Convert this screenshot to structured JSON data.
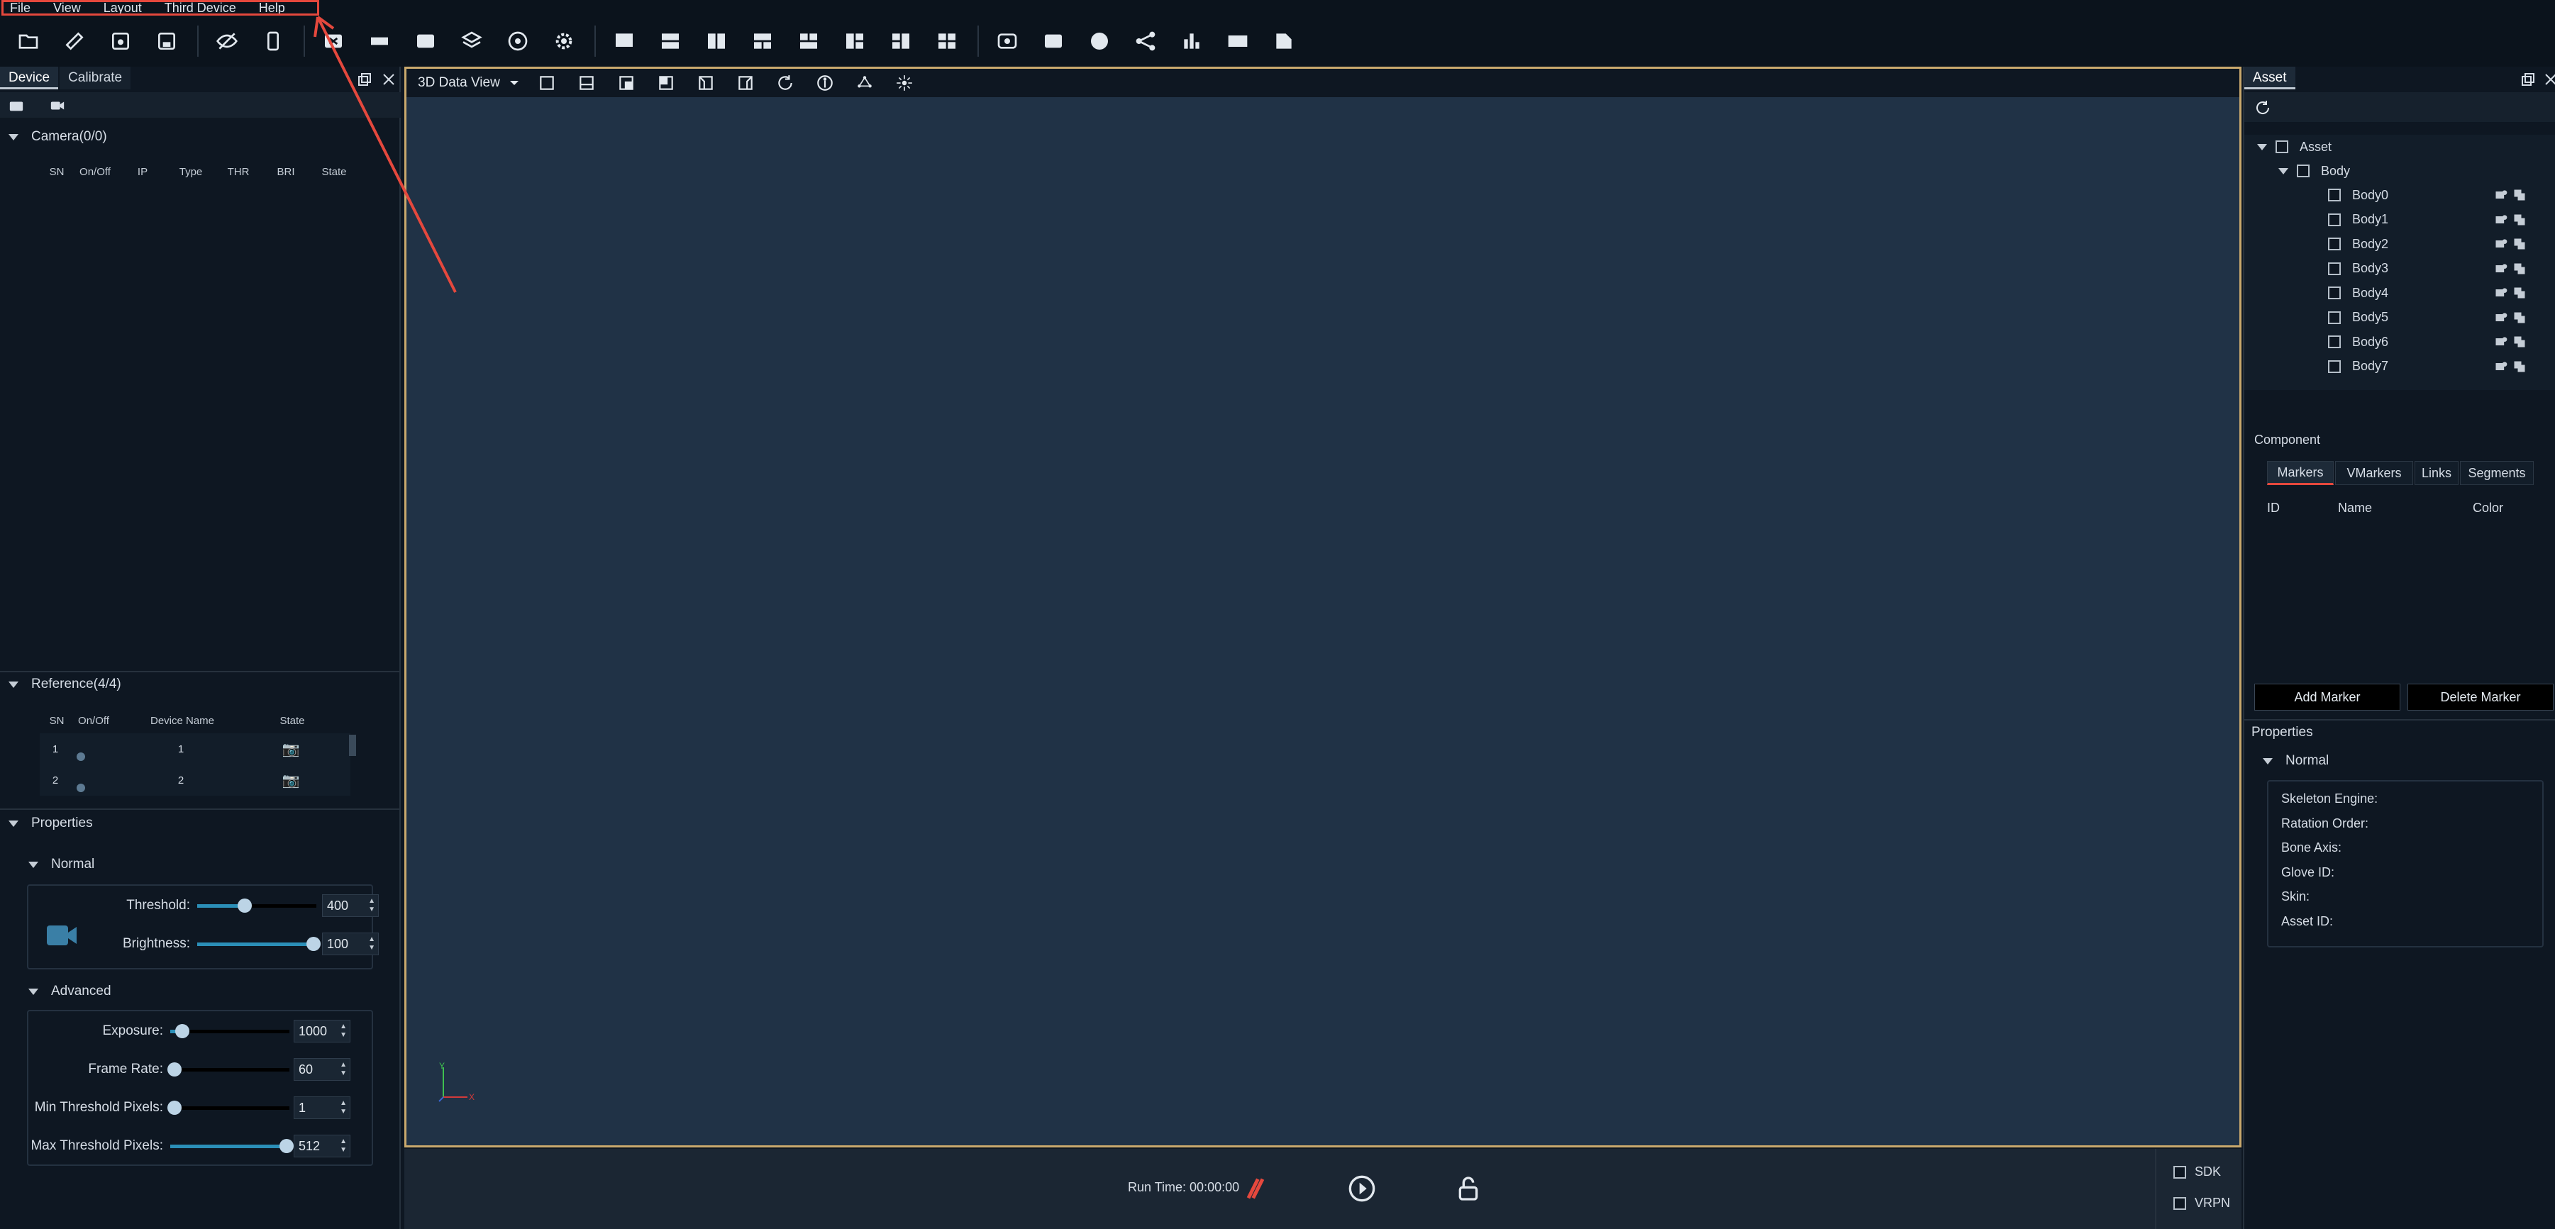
{
  "menu": [
    "File",
    "View",
    "Layout",
    "Third Device",
    "Help"
  ],
  "toolbar_icons": [
    "folder-open-icon",
    "ruler-icon",
    "save-icon",
    "save-as-icon",
    "hide-icon",
    "phone-icon",
    "close-device-icon",
    "measure-icon",
    "record-icon",
    "layers-icon",
    "wifi-icon",
    "settings-icon",
    "layout-1-icon",
    "layout-2-icon",
    "layout-3-icon",
    "layout-4-icon",
    "layout-5-icon",
    "layout-6-icon",
    "layout-7-icon",
    "layout-8-icon",
    "camera-refresh-icon",
    "2d-view-icon",
    "3d-view-icon",
    "graph-icon",
    "chart-icon",
    "vm-icon",
    "export-icon"
  ],
  "left": {
    "tabs": [
      "Device",
      "Calibrate"
    ],
    "camera": {
      "title": "Camera(0/0)",
      "columns": [
        "SN",
        "On/Off",
        "IP",
        "Type",
        "THR",
        "BRI",
        "State"
      ]
    },
    "reference": {
      "title": "Reference(4/4)",
      "columns": [
        "SN",
        "On/Off",
        "Device Name",
        "State"
      ],
      "rows": [
        {
          "sn": "1",
          "name": "1"
        },
        {
          "sn": "2",
          "name": "2"
        }
      ]
    },
    "properties": {
      "title": "Properties",
      "normal_title": "Normal",
      "advanced_title": "Advanced",
      "threshold": {
        "label": "Threshold:",
        "value": "400",
        "level": 0.4
      },
      "brightness": {
        "label": "Brightness:",
        "value": "100",
        "level": 1.0
      },
      "exposure": {
        "label": "Exposure:",
        "value": "1000",
        "level": 0.1
      },
      "frame_rate": {
        "label": "Frame Rate:",
        "value": "60",
        "level": 0.0
      },
      "min_threshold": {
        "label": "Min Threshold Pixels:",
        "value": "1",
        "level": 0.0
      },
      "max_threshold": {
        "label": "Max Threshold Pixels:",
        "value": "512",
        "level": 1.0
      }
    }
  },
  "view": {
    "mode": "3D Data View",
    "axis_y": "Y",
    "axis_x": "X"
  },
  "bottom": {
    "run_time_label": "Run Time:",
    "run_time_value": "00:00:00",
    "sdk": "SDK",
    "vrpn": "VRPN"
  },
  "right": {
    "tab": "Asset",
    "tree": {
      "root": "Asset",
      "group": "Body",
      "items": [
        "Body0",
        "Body1",
        "Body2",
        "Body3",
        "Body4",
        "Body5",
        "Body6",
        "Body7"
      ]
    },
    "component": {
      "title": "Component",
      "tabs": [
        "Markers",
        "VMarkers",
        "Links",
        "Segments"
      ],
      "columns": [
        "ID",
        "Name",
        "Color"
      ],
      "add_button": "Add Marker",
      "delete_button": "Delete Marker"
    },
    "properties": {
      "title": "Properties",
      "normal_title": "Normal",
      "fields": [
        "Skeleton Engine:",
        "Ratation Order:",
        "Bone Axis:",
        "Glove ID:",
        "Skin:",
        "Asset ID:"
      ]
    }
  },
  "colors": {
    "accent": "#2b8fb8",
    "highlight": "#e5483d",
    "view_border": "#caa96d",
    "view_bg": "#203246"
  }
}
